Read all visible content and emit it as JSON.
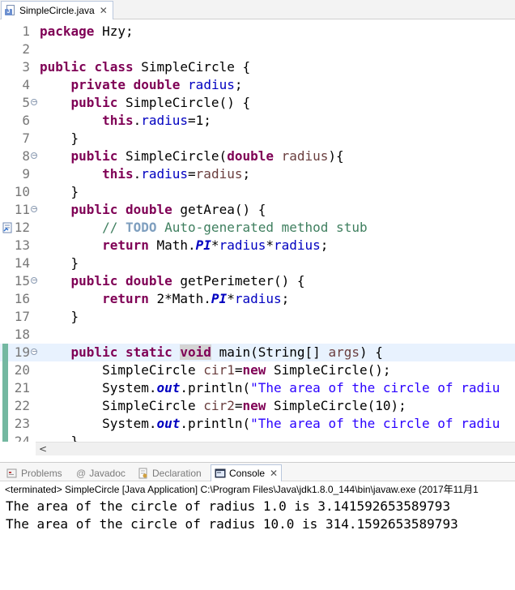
{
  "editor": {
    "tab": {
      "title": "SimpleCircle.java"
    },
    "lines": [
      {
        "num": "1"
      },
      {
        "num": "2"
      },
      {
        "num": "3"
      },
      {
        "num": "4"
      },
      {
        "num": "5"
      },
      {
        "num": "6"
      },
      {
        "num": "7"
      },
      {
        "num": "8"
      },
      {
        "num": "9"
      },
      {
        "num": "10"
      },
      {
        "num": "11"
      },
      {
        "num": "12"
      },
      {
        "num": "13"
      },
      {
        "num": "14"
      },
      {
        "num": "15"
      },
      {
        "num": "16"
      },
      {
        "num": "17"
      },
      {
        "num": "18"
      },
      {
        "num": "19"
      },
      {
        "num": "20"
      },
      {
        "num": "21"
      },
      {
        "num": "22"
      },
      {
        "num": "23"
      },
      {
        "num": "24"
      }
    ],
    "t": {
      "l1": [
        "package",
        " Hzy;"
      ],
      "l3": [
        "public",
        " ",
        "class",
        " SimpleCircle {"
      ],
      "l4": [
        "    ",
        "private",
        " ",
        "double",
        " ",
        "radius",
        ";"
      ],
      "l5": [
        "    ",
        "public",
        " SimpleCircle() {"
      ],
      "l6": [
        "        ",
        "this",
        ".",
        "radius",
        "=1;"
      ],
      "l7": [
        "    }"
      ],
      "l8": [
        "    ",
        "public",
        " SimpleCircle(",
        "double",
        " ",
        "radius",
        "){"
      ],
      "l9": [
        "        ",
        "this",
        ".",
        "radius",
        "=",
        "radius",
        ";"
      ],
      "l10": [
        "    }"
      ],
      "l11": [
        "    ",
        "public",
        " ",
        "double",
        " getArea() {"
      ],
      "l12": [
        "        ",
        "// ",
        "TODO",
        " Auto-generated method stub"
      ],
      "l13": [
        "        ",
        "return",
        " Math.",
        "PI",
        "*",
        "radius",
        "*",
        "radius",
        ";"
      ],
      "l14": [
        "    }"
      ],
      "l15": [
        "    ",
        "public",
        " ",
        "double",
        " getPerimeter() {"
      ],
      "l16": [
        "        ",
        "return",
        " 2*Math.",
        "PI",
        "*",
        "radius",
        ";"
      ],
      "l17": [
        "    }"
      ],
      "l19": [
        "    ",
        "public",
        " ",
        "static",
        " ",
        "void",
        " main(String[] ",
        "args",
        ") {"
      ],
      "l20": [
        "        SimpleCircle ",
        "cir1",
        "=",
        "new",
        " SimpleCircle();"
      ],
      "l21": [
        "        System.",
        "out",
        ".println(",
        "\"The area of the circle of radiu"
      ],
      "l22": [
        "        SimpleCircle ",
        "cir2",
        "=",
        "new",
        " SimpleCircle(10);"
      ],
      "l23": [
        "        System.",
        "out",
        ".println(",
        "\"The area of the circle of radiu"
      ],
      "l24": [
        "    }"
      ]
    }
  },
  "views": {
    "tabs": [
      {
        "label": "Problems"
      },
      {
        "label": "Javadoc"
      },
      {
        "label": "Declaration"
      },
      {
        "label": "Console"
      }
    ]
  },
  "console": {
    "header": "<terminated> SimpleCircle [Java Application] C:\\Program Files\\Java\\jdk1.8.0_144\\bin\\javaw.exe (2017年11月1",
    "output": [
      "The area of the circle of radius 1.0 is 3.141592653589793",
      "The area of the circle of radius 10.0 is 314.1592653589793"
    ]
  },
  "colors": {
    "keyword": "#7f0055",
    "field": "#0000c0",
    "string": "#2a00ff",
    "comment": "#3f7f5f",
    "current_line": "#e8f2fe",
    "marker": "#74b8a1"
  }
}
